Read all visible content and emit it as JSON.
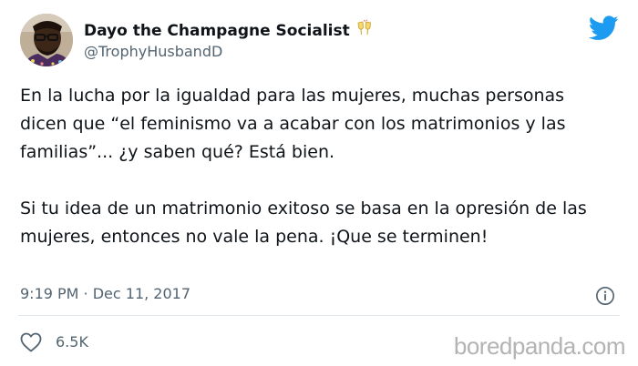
{
  "author": {
    "display_name": "Dayo the Champagne Socialist",
    "emoji_icon": "clinking-glasses-icon",
    "handle": "@TrophyHusbandD"
  },
  "brand": {
    "icon": "twitter-bird-icon",
    "color": "#1d9bf0"
  },
  "tweet": {
    "paragraph_1": "En la lucha por la igualdad para las mujeres, muchas personas dicen que “el feminismo va a acabar con los matrimonios y las familias”... ¿y saben qué? Está bien.",
    "paragraph_2": "Si tu idea de un matrimonio exitoso se basa en la opresión de las mujeres, entonces no vale la pena. ¡Que se terminen!",
    "timestamp": "9:19 PM · Dec 11, 2017"
  },
  "engagement": {
    "like_icon": "heart-icon",
    "like_count": "6.5K",
    "info_icon": "info-icon"
  },
  "watermark": {
    "text": "boredpanda.com"
  },
  "colors": {
    "text_primary": "#0f1419",
    "text_secondary": "#536471",
    "divider": "#e1e8ed",
    "watermark": "#b3b3b3"
  }
}
